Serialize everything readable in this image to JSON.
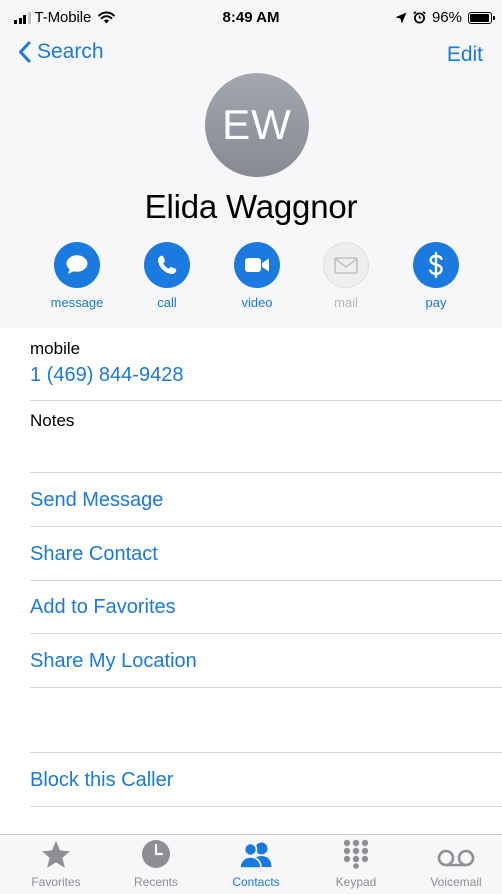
{
  "status_bar": {
    "carrier": "T-Mobile",
    "time": "8:49 AM",
    "battery": "96%",
    "battery_level": 0.96,
    "signal_bars": 3,
    "signal_max": 4
  },
  "nav": {
    "back_label": "Search",
    "edit_label": "Edit"
  },
  "contact": {
    "initials": "EW",
    "name": "Elida Waggnor"
  },
  "actions": [
    {
      "label": "message",
      "icon": "message-bubble-icon",
      "enabled": true
    },
    {
      "label": "call",
      "icon": "phone-icon",
      "enabled": true
    },
    {
      "label": "video",
      "icon": "video-camera-icon",
      "enabled": true
    },
    {
      "label": "mail",
      "icon": "envelope-icon",
      "enabled": false
    },
    {
      "label": "pay",
      "icon": "dollar-icon",
      "enabled": true
    }
  ],
  "phone_field": {
    "label": "mobile",
    "value": "1 (469) 844-9428"
  },
  "notes_label": "Notes",
  "links": {
    "send_message": "Send Message",
    "share_contact": "Share Contact",
    "add_to_favorites": "Add to Favorites",
    "share_location": "Share My Location",
    "block_caller": "Block this Caller"
  },
  "tabs": [
    {
      "label": "Favorites",
      "icon": "star-icon",
      "active": false
    },
    {
      "label": "Recents",
      "icon": "clock-icon",
      "active": false
    },
    {
      "label": "Contacts",
      "icon": "contacts-icon",
      "active": true
    },
    {
      "label": "Keypad",
      "icon": "keypad-icon",
      "active": false
    },
    {
      "label": "Voicemail",
      "icon": "voicemail-icon",
      "active": false
    }
  ],
  "colors": {
    "accent": "#1a7ae0",
    "inactive": "#8e8e93",
    "disabled": "#b7b7bb",
    "avatar": "#8e939b"
  }
}
